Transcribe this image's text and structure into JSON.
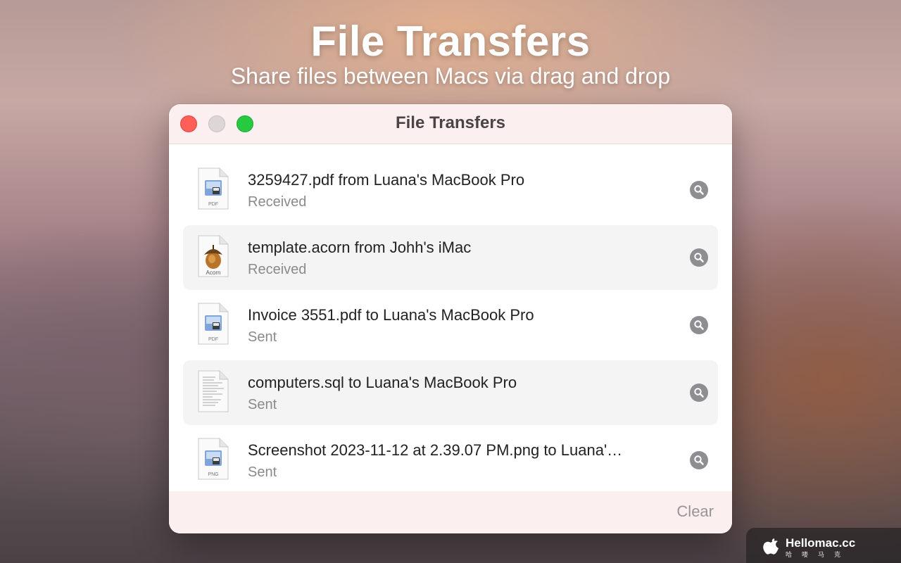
{
  "hero": {
    "title": "File Transfers",
    "subtitle": "Share files between Macs via drag and drop"
  },
  "window": {
    "title": "File Transfers",
    "clear_label": "Clear"
  },
  "transfers": [
    {
      "title": "3259427.pdf from Luana's MacBook Pro",
      "status": "Received",
      "icon": "pdf-file-icon",
      "icon_label": "PDF"
    },
    {
      "title": "template.acorn from Johh's iMac",
      "status": "Received",
      "icon": "acorn-file-icon",
      "icon_label": "Acorn"
    },
    {
      "title": "Invoice 3551.pdf to Luana's MacBook Pro",
      "status": "Sent",
      "icon": "pdf-file-icon",
      "icon_label": "PDF"
    },
    {
      "title": "computers.sql to Luana's MacBook Pro",
      "status": "Sent",
      "icon": "text-file-icon",
      "icon_label": ""
    },
    {
      "title": "Screenshot 2023-11-12 at 2.39.07 PM.png to Luana'…",
      "status": "Sent",
      "icon": "png-file-icon",
      "icon_label": "PNG"
    }
  ],
  "watermark": {
    "text": "Hellomac.cc",
    "sub": "哈喽马克"
  },
  "colors": {
    "close": "#fe5f57",
    "minimize": "#dcd6d6",
    "maximize": "#28c840",
    "titlebar": "#fbeff0"
  }
}
